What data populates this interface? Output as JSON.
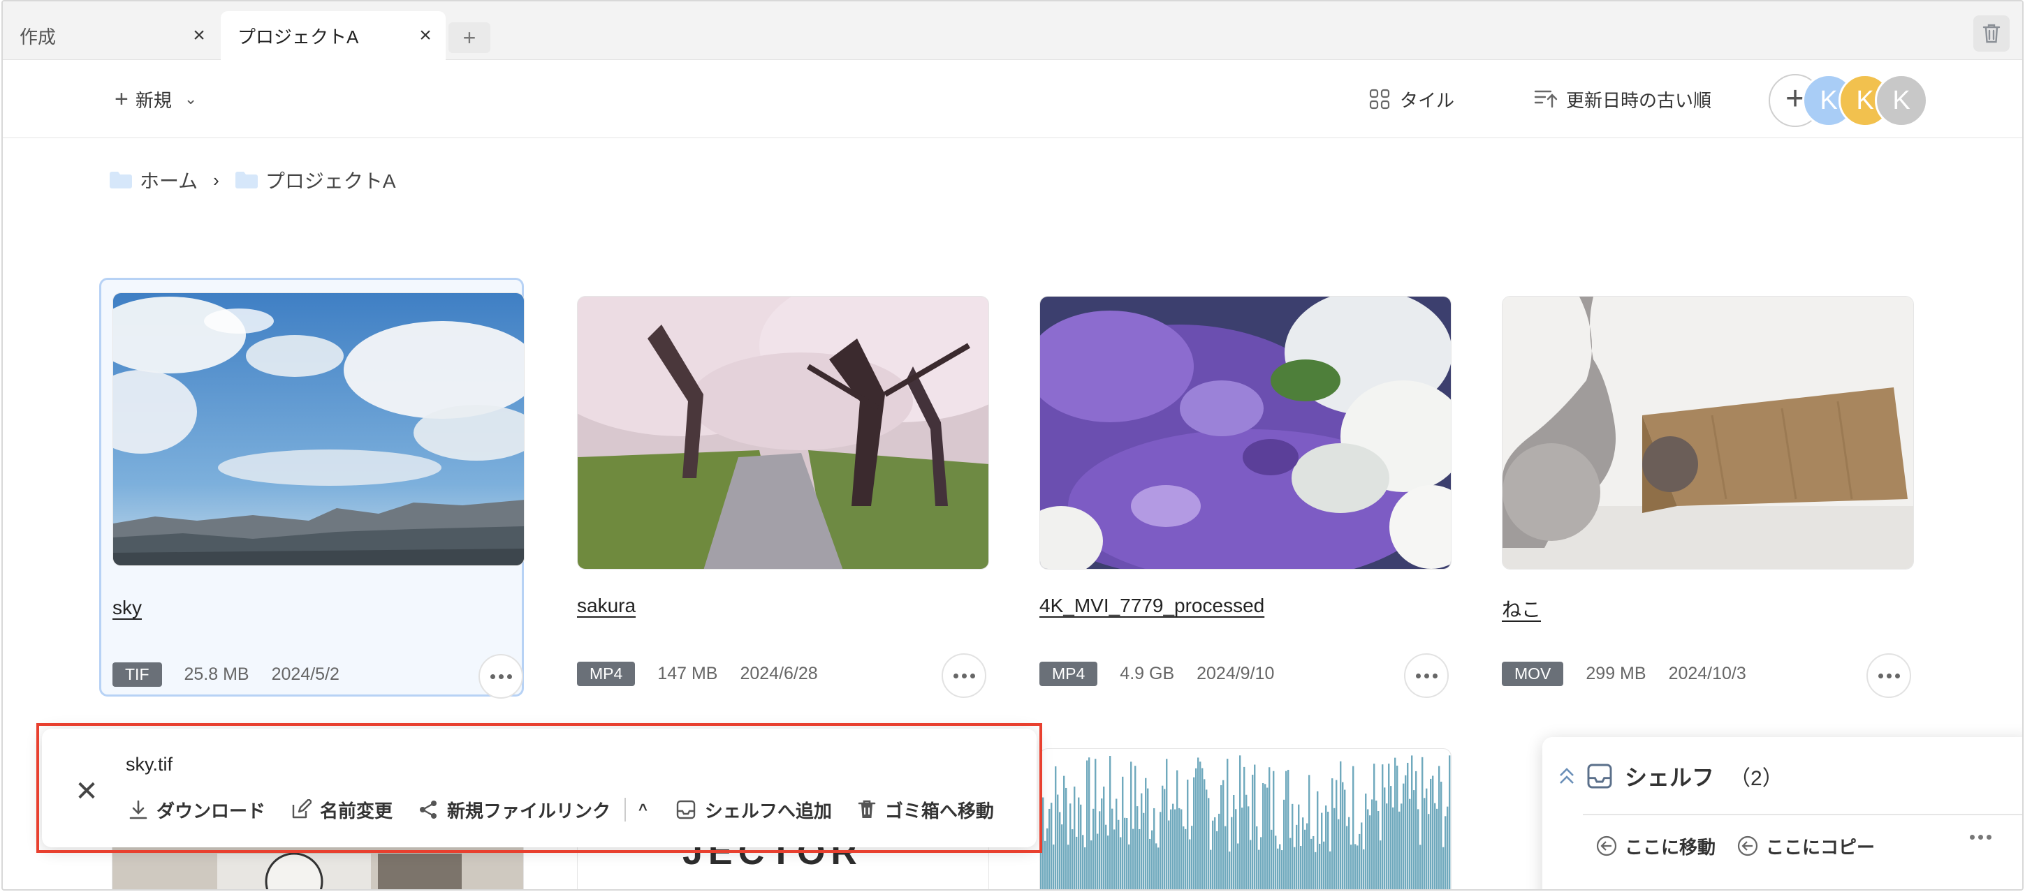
{
  "tabs": [
    {
      "label": "作成",
      "close": "×"
    },
    {
      "label": "プロジェクトA",
      "close": "×"
    }
  ],
  "tab_add": "+",
  "toolbar": {
    "new_label": "新規",
    "view_label": "タイル",
    "sort_label": "更新日時の古い順"
  },
  "avatars": {
    "add": "+",
    "users": [
      "K",
      "K",
      "K"
    ],
    "colors": [
      "#a9cdf6",
      "#f2c14e",
      "#c8c8c8"
    ]
  },
  "breadcrumb": {
    "home": "ホーム",
    "separator": "›",
    "current": "プロジェクトA"
  },
  "files": [
    {
      "name": "sky",
      "type": "TIF",
      "size": "25.8 MB",
      "date": "2024/5/2",
      "selected": true
    },
    {
      "name": "sakura",
      "type": "MP4",
      "size": "147 MB",
      "date": "2024/6/28"
    },
    {
      "name": "4K_MVI_7779_processed",
      "type": "MP4",
      "size": "4.9 GB",
      "date": "2024/9/10"
    },
    {
      "name": "ねこ",
      "type": "MOV",
      "size": "299 MB",
      "date": "2024/10/3"
    }
  ],
  "partial_thumb_text": "JECTOR",
  "action_bar": {
    "close": "✕",
    "filename": "sky.tif",
    "download": "ダウンロード",
    "rename": "名前変更",
    "new_link": "新規ファイルリンク",
    "collapse": "^",
    "add_to_shelf": "シェルフへ追加",
    "move_to_trash": "ゴミ箱へ移動"
  },
  "shelf": {
    "title": "シェルフ",
    "count": "（2）",
    "move_here": "ここに移動",
    "copy_here": "ここにコピー"
  },
  "colors": {
    "accent_border": "#b7d2f5",
    "highlight": "#e8402f",
    "badge": "#6a7078",
    "waveform": "#6fa9bd"
  }
}
